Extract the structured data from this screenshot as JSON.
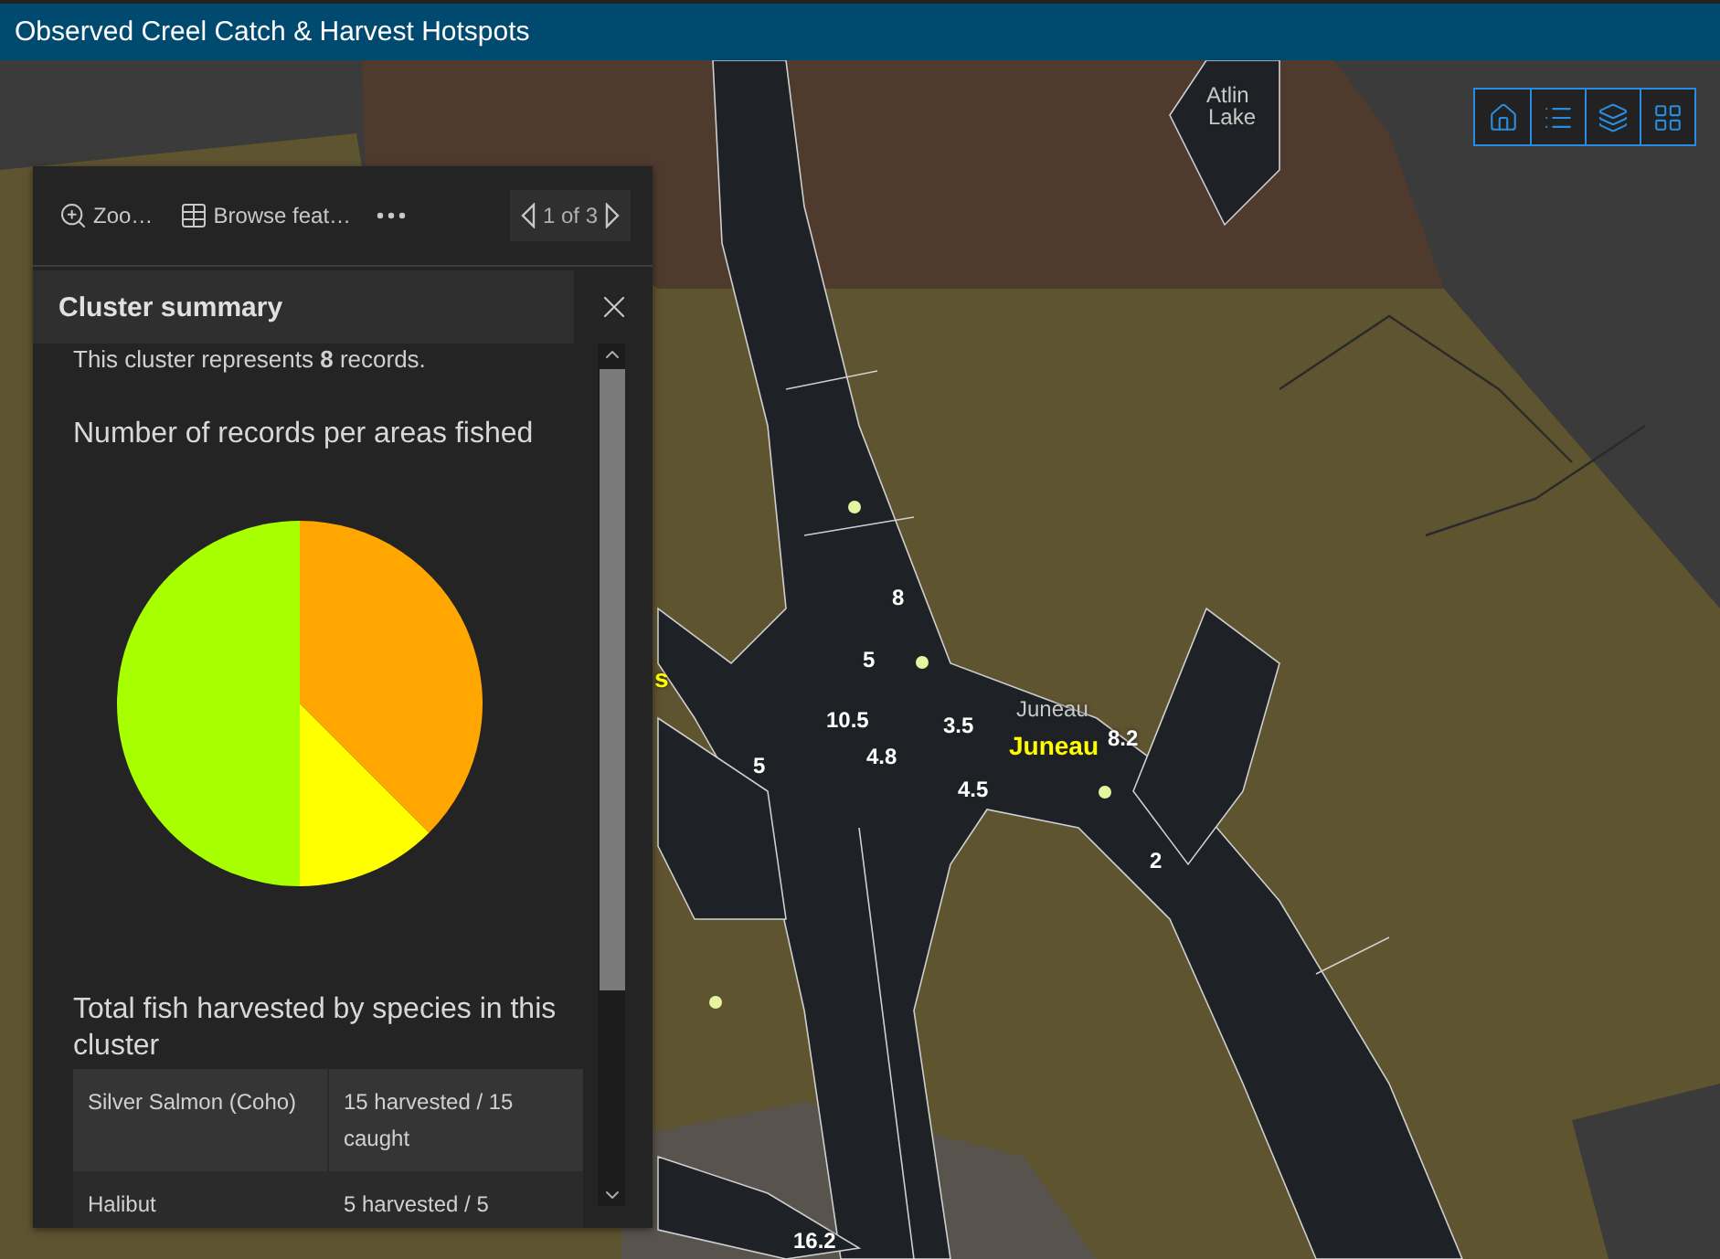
{
  "header": {
    "title": "Observed Creel Catch & Harvest Hotspots"
  },
  "map_labels": [
    {
      "kind": "place",
      "text": "Atlin"
    },
    {
      "kind": "place",
      "text": "Lake"
    },
    {
      "kind": "highlight",
      "text": "s"
    },
    {
      "kind": "value",
      "text": "8"
    },
    {
      "kind": "value",
      "text": "5"
    },
    {
      "kind": "value",
      "text": "10.5"
    },
    {
      "kind": "value",
      "text": "4.8"
    },
    {
      "kind": "value",
      "text": "3.5"
    },
    {
      "kind": "place",
      "text": "Juneau"
    },
    {
      "kind": "highlight",
      "text": "Juneau"
    },
    {
      "kind": "value",
      "text": "8.2"
    },
    {
      "kind": "value",
      "text": "4.5"
    },
    {
      "kind": "value",
      "text": "5"
    },
    {
      "kind": "value",
      "text": "2"
    },
    {
      "kind": "value",
      "text": "16.2"
    }
  ],
  "popup": {
    "toolbar": {
      "zoom": "Zoo…",
      "browse": "Browse feat…",
      "pager": "1 of 3"
    },
    "title": "Cluster summary",
    "summary": "This cluster represents **8** records.",
    "chart_title": "Number of records per areas fished",
    "chart_data": {
      "type": "pie",
      "values": [
        37.5,
        12.5,
        50
      ],
      "colors": [
        "#ffa600",
        "#ffff00",
        "#a8ff00"
      ]
    },
    "table_title": "Total fish harvested by species in this cluster",
    "table_rows": [
      [
        "Silver Salmon (Coho)",
        "15 harvested / 15 caught"
      ],
      [
        "Halibut",
        "5 harvested / 5"
      ]
    ]
  }
}
